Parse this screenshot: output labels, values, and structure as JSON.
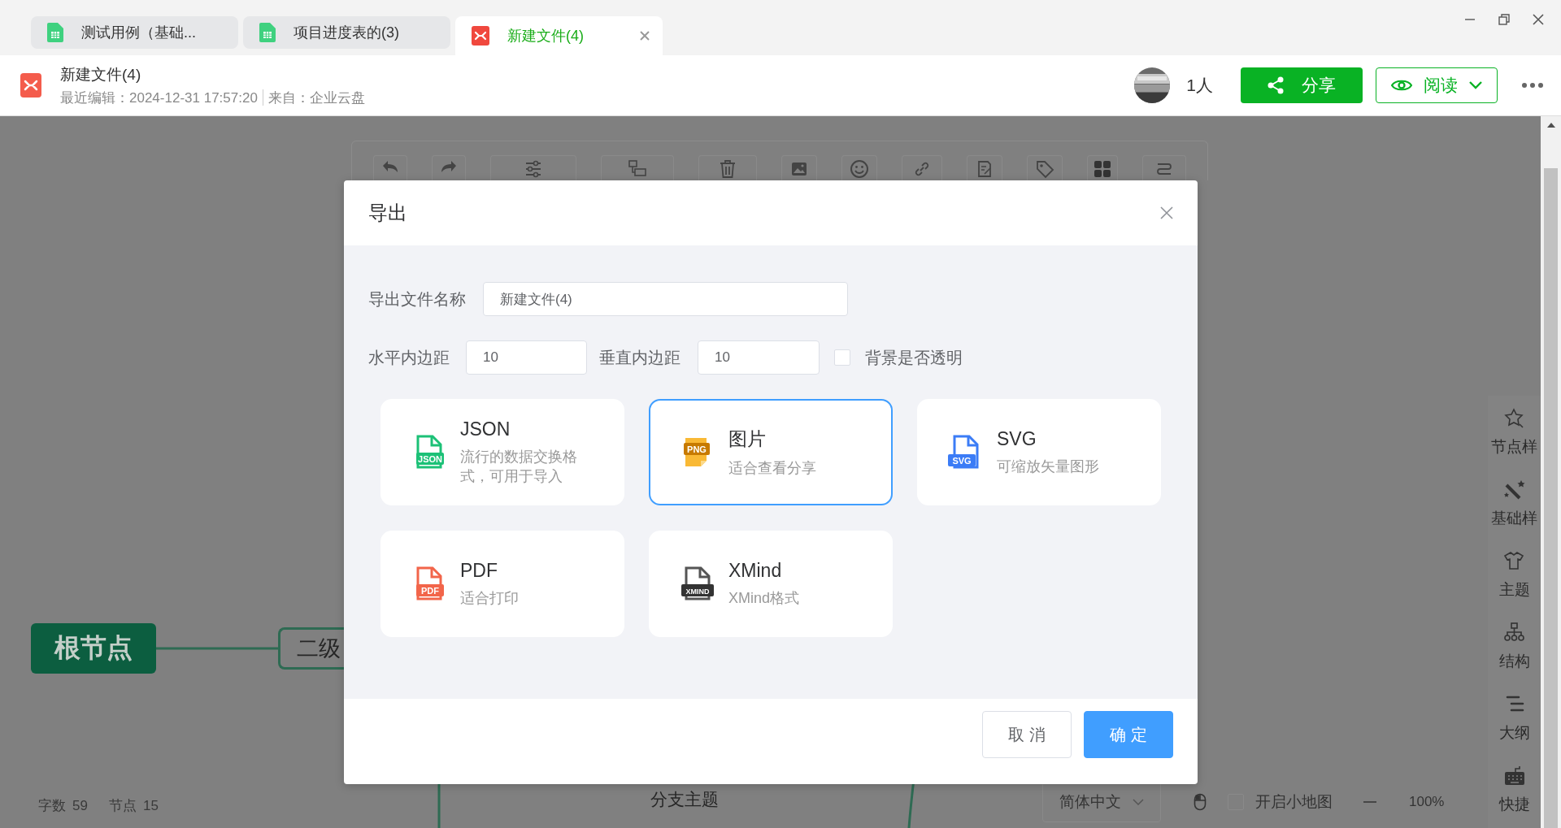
{
  "tabs": [
    {
      "label": "测试用例（基础...",
      "kind": "sheet",
      "selected": false
    },
    {
      "label": "项目进度表的(3)",
      "kind": "sheet",
      "selected": false
    },
    {
      "label": "新建文件(4)",
      "kind": "mindmap",
      "selected": true
    }
  ],
  "document": {
    "title": "新建文件(4)",
    "edited": "最近编辑：2024-12-31 17:57:20",
    "source": "来自：企业云盘"
  },
  "collaborators": {
    "count": "1人"
  },
  "share_button": "分享",
  "read_button": "阅读",
  "mind_map": {
    "root": "根节点",
    "child": "二级",
    "branch": "分支主题"
  },
  "status_bar": {
    "words_label": "字数",
    "words": "59",
    "nodes_label": "节点",
    "nodes": "15",
    "language": "简体中文",
    "minimap": {
      "label": "开启小地图",
      "checked": false
    },
    "zoom": "100%"
  },
  "sidebar": {
    "items": [
      {
        "label": "节点样",
        "kind": "node-style"
      },
      {
        "label": "基础样",
        "kind": "base-style"
      },
      {
        "label": "主题",
        "kind": "theme"
      },
      {
        "label": "结构",
        "kind": "structure"
      },
      {
        "label": "大纲",
        "kind": "outline"
      },
      {
        "label": "快捷",
        "kind": "shortcut"
      }
    ]
  },
  "dialog": {
    "title": "导出",
    "file_name": {
      "label": "导出文件名称",
      "value": "新建文件(4)"
    },
    "h_padding": {
      "label": "水平内边距",
      "value": "10"
    },
    "v_padding": {
      "label": "垂直内边距",
      "value": "10"
    },
    "transparent": {
      "label": "背景是否透明",
      "checked": false
    },
    "formats": [
      {
        "kind": "json",
        "name": "JSON",
        "badge": "JSON",
        "description": "流行的数据交换格式，可用于导入",
        "selected": false
      },
      {
        "kind": "png",
        "name": "图片",
        "badge": "PNG",
        "description": "适合查看分享",
        "selected": true
      },
      {
        "kind": "svg",
        "name": "SVG",
        "badge": "SVG",
        "description": "可缩放矢量图形",
        "selected": false
      },
      {
        "kind": "pdf",
        "name": "PDF",
        "badge": "PDF",
        "description": "适合打印",
        "selected": false
      },
      {
        "kind": "xmind",
        "name": "XMind",
        "badge": "XMIND",
        "description": "XMind格式",
        "selected": false
      }
    ],
    "buttons": {
      "cancel": "取 消",
      "confirm": "确 定"
    }
  }
}
